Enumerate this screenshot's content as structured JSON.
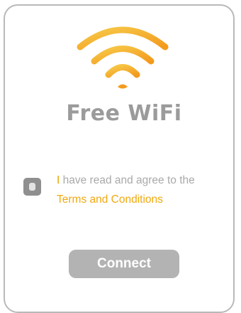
{
  "page": {
    "title": "Free WiFi"
  },
  "agreement": {
    "first_letter": "I",
    "text_rest": " have read and agree to the",
    "terms_link": "Terms and Conditions",
    "checked": false
  },
  "actions": {
    "connect_label": "Connect"
  },
  "icons": {
    "wifi": "wifi-icon",
    "checkbox": "checkbox-icon"
  },
  "colors": {
    "accent_orange": "#f5a623",
    "accent_light": "#f7c948",
    "title_gray": "#9b9b9b",
    "button_gray": "#b3b3b3",
    "border_gray": "#b9b9b9"
  }
}
